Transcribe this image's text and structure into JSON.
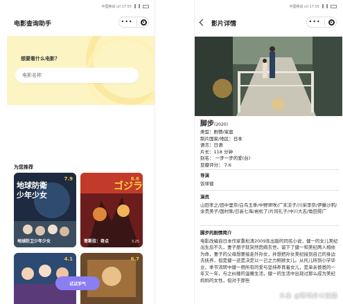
{
  "left": {
    "status": "中国移动 ull 17:55",
    "nav_title": "电影查询助手",
    "capsule_more": "•••",
    "hero_prompt": "想要看什么电影？",
    "search_placeholder": "电影名称",
    "recommend_title": "为您推荐",
    "cards": [
      {
        "name": "地球防卫少年少女",
        "rating": "7.9",
        "year": ""
      },
      {
        "name": "哥斯拉：奇点",
        "rating": "8.6",
        "year": "3.25"
      },
      {
        "name": "",
        "rating": "4.1",
        "year": ""
      },
      {
        "name": "",
        "rating": "6.7",
        "year": ""
      }
    ],
    "luck_button": "试试手气"
  },
  "right": {
    "status": "中国移动 ull 17:55",
    "nav_title": "影片详情",
    "capsule_more": "•••",
    "movie": {
      "title": "脚步",
      "year": "(2020)",
      "genre": "类型：剧情/家庭",
      "country": "制片国家/地区：日本",
      "language": "语言：日语",
      "runtime": "片长：118 分钟",
      "aka": "别名：  一步一步的爱(台)",
      "douban": "豆瓣评分：  7.6"
    },
    "director_title": "导演",
    "director": "饭塚健",
    "cast_title": "演员",
    "cast": "山田孝之/田中里奈/白鸟玉季/中野翠咲/广末凉子/川栄李奈/伊藤沙莉/余贵美子/国村隼/日高七海/岩松了/片冈礼子/中川大志/角田晃广",
    "plot_title": "脚步的剧情简介",
    "plot": "电影改编自日本作家重松清2009年出版的同名小说，健一的女儿美纪出生后不久，妻子朋子就突然因病去世。留下了健一和美纪两人相依为命，妻子的父母想要接走外孙女，并想把孙女美纪接到自己的身边去抚养，但是健一还是决定以一己之力照顾女儿。从托儿所到小学毕业，季节流转中健一用所有的爱与坚持养育着女儿，是单亲爸爸的一年又一年，与之纠缠的温暖生活，健一的生活中出现过那么成为美纪妈妈的女性，但对于那些"
  },
  "watermark": "头条 @职场办公技能",
  "colors": {
    "accent": "#8b7df2",
    "hero": "#fdf4c4",
    "rating": "#f2c94c"
  }
}
